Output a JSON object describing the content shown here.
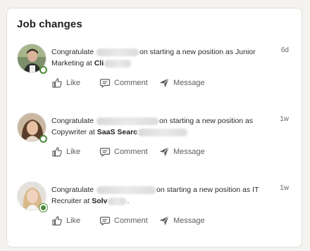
{
  "card": {
    "title": "Job changes"
  },
  "items": [
    {
      "text_prefix": "Congratulate",
      "text_suffix": "on starting a new position as Junior Marketing at",
      "company": "Cli",
      "time": "6d"
    },
    {
      "text_prefix": "Congratulate",
      "text_suffix": "on starting a new position as Copywriter at",
      "company": "SaaS Searc",
      "time": "1w"
    },
    {
      "text_prefix": "Congratulate",
      "text_suffix": "on starting a new position as IT Recruiter at",
      "company": "Solv",
      "text_end": ".",
      "time": "1w"
    }
  ],
  "actions": {
    "like": "Like",
    "comment": "Comment",
    "message": "Message"
  },
  "colors": {
    "presence": "#4c8a3a",
    "muted_text": "#5e5e5e"
  },
  "icons": [
    "thumbs-up-icon",
    "comment-bubble-icon",
    "send-message-icon"
  ]
}
